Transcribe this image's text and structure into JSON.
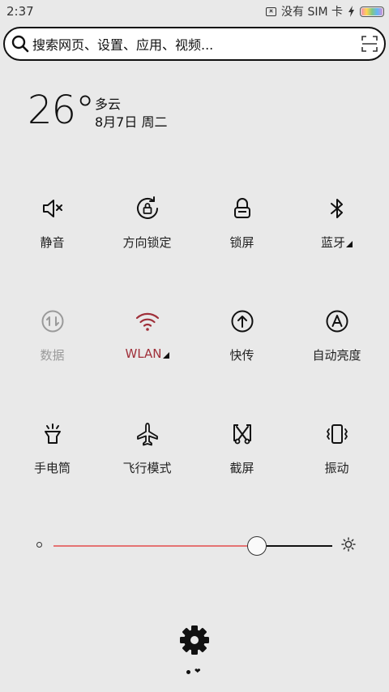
{
  "status_bar": {
    "time": "2:37",
    "sim_text": "没有 SIM 卡",
    "icons": [
      "no-sim-icon",
      "charging-icon",
      "battery-icon"
    ]
  },
  "search": {
    "placeholder": "搜索网页、设置、应用、视频...",
    "icons": [
      "search-icon",
      "scan-icon"
    ]
  },
  "weather": {
    "temperature": "26°",
    "condition": "多云",
    "date": "8月7日 周二"
  },
  "toggles": [
    {
      "label": "静音",
      "icon": "mute-icon",
      "state": "normal"
    },
    {
      "label": "方向锁定",
      "icon": "rotation-lock-icon",
      "state": "normal"
    },
    {
      "label": "锁屏",
      "icon": "lock-icon",
      "state": "normal"
    },
    {
      "label": "蓝牙",
      "icon": "bluetooth-icon",
      "state": "normal",
      "has_more": true
    },
    {
      "label": "数据",
      "icon": "mobile-data-icon",
      "state": "disabled"
    },
    {
      "label": "WLAN",
      "icon": "wifi-icon",
      "state": "active",
      "has_more": true
    },
    {
      "label": "快传",
      "icon": "quick-transfer-icon",
      "state": "normal"
    },
    {
      "label": "自动亮度",
      "icon": "auto-brightness-icon",
      "state": "normal"
    },
    {
      "label": "手电筒",
      "icon": "flashlight-icon",
      "state": "normal"
    },
    {
      "label": "飞行模式",
      "icon": "airplane-icon",
      "state": "normal"
    },
    {
      "label": "截屏",
      "icon": "screenshot-icon",
      "state": "normal"
    },
    {
      "label": "振动",
      "icon": "vibrate-icon",
      "state": "normal"
    }
  ],
  "brightness": {
    "level": 0.73,
    "fill_color": "#e57373"
  },
  "colors": {
    "active": "#a0303a",
    "disabled": "#9a9a9a",
    "background": "#e9e9e9"
  },
  "footer": {
    "icon": "settings-icon"
  }
}
